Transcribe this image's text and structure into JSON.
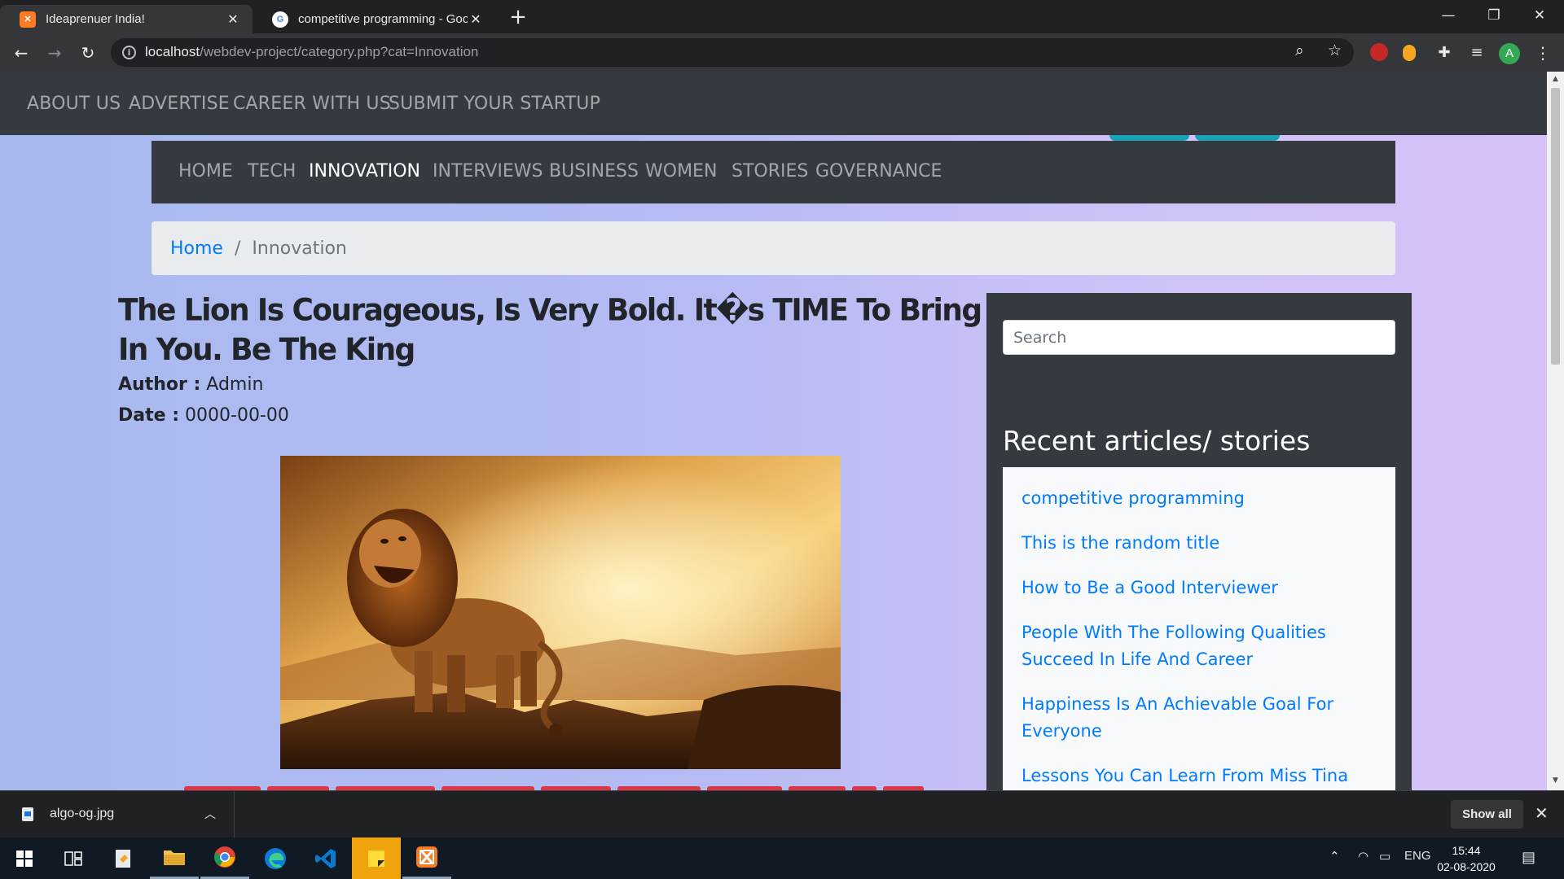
{
  "browser": {
    "tabs": [
      {
        "title": "Ideaprenuer India!",
        "active": true,
        "favicon": "xampp-icon"
      },
      {
        "title": "competitive programming - Goo",
        "active": false,
        "favicon": "google-icon"
      }
    ],
    "url_host": "localhost",
    "url_path": "/webdev-project/category.php?cat=Innovation",
    "profile_initial": "A"
  },
  "top_nav": {
    "items": [
      "ABOUT US",
      "ADVERTISE",
      "CAREER WITH US",
      "SUBMIT YOUR STARTUP"
    ]
  },
  "category_nav": {
    "items": [
      "HOME",
      "TECH",
      "INNOVATION",
      "INTERVIEWS",
      "BUSINESS",
      "WOMEN",
      "STORIES",
      "GOVERNANCE"
    ],
    "active": "INNOVATION"
  },
  "breadcrumb": {
    "home": "Home",
    "separator": "/",
    "current": "Innovation"
  },
  "article": {
    "title_line1": "The Lion Is Courageous, Is Very Bold. It�s TIME To Bring Out Your Lion",
    "title_line2": "In You. Be The King",
    "author_label": "Author :",
    "author": "Admin",
    "date_label": "Date :",
    "date": "0000-00-00"
  },
  "sidebar": {
    "search_placeholder": "Search",
    "recent_heading": "Recent articles/ stories",
    "recent_items": [
      "competitive programming",
      "This is the random title",
      "How to Be a Good Interviewer",
      "People With The Following Qualities Succeed In Life And Career",
      "Happiness Is An Achievable Goal For Everyone",
      "Lessons You Can Learn From Miss Tina Dabi,"
    ]
  },
  "downloads": {
    "file_name": "algo-og.jpg",
    "show_all": "Show all"
  },
  "taskbar": {
    "language": "ENG",
    "time": "15:44",
    "date": "02-08-2020"
  },
  "colors": {
    "nav_bg": "#343a40",
    "link": "#007bff",
    "accent_teal": "#17a2b8",
    "strip_red": "#dc3545"
  }
}
